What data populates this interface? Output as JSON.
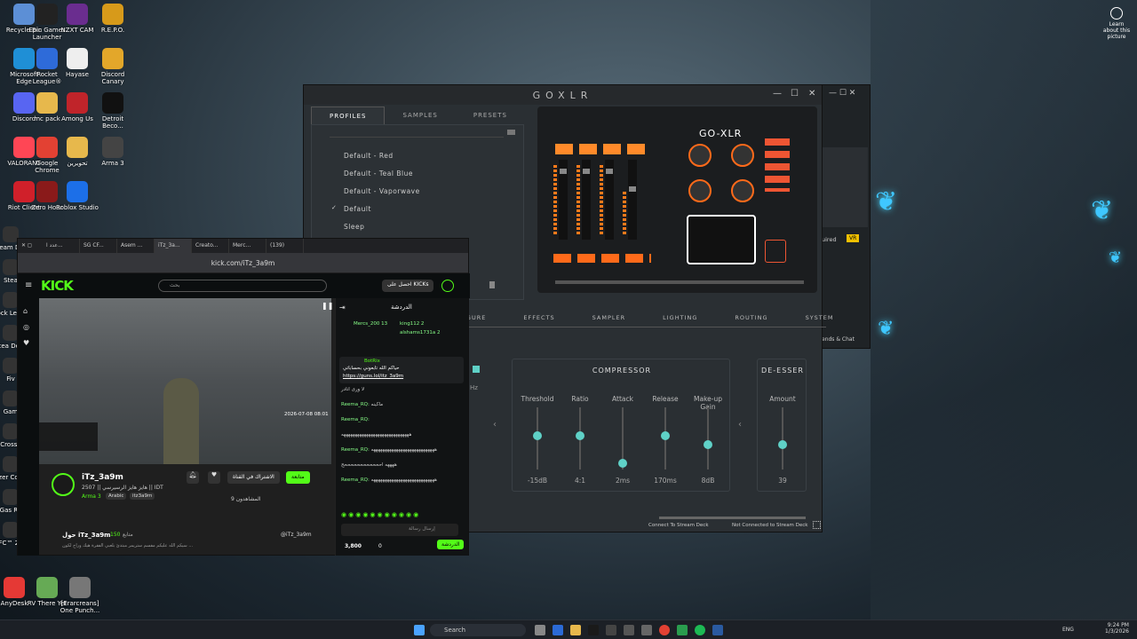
{
  "desktop": {
    "icons": [
      {
        "label": "Recycle Bin",
        "color": "#5c8fd6"
      },
      {
        "label": "Epic Games Launcher",
        "color": "#222",
        "glyph": "EPIC GAMES"
      },
      {
        "label": "NZXT CAM",
        "color": "#6a2d8f",
        "glyph": "NZXT"
      },
      {
        "label": "R.E.P.O.",
        "color": "#d79a1a"
      },
      {
        "label": "Microsoft Edge",
        "color": "#1f8fd6"
      },
      {
        "label": "Rocket League®",
        "color": "#2e6bd9"
      },
      {
        "label": "Hayase",
        "color": "#eee"
      },
      {
        "label": "Discord Canary",
        "color": "#e3a72a"
      },
      {
        "label": "Discord",
        "color": "#5865f2"
      },
      {
        "label": "mc pack",
        "color": "#e7b84c"
      },
      {
        "label": "Among Us",
        "color": "#c0242a"
      },
      {
        "label": "Detroit Beco...",
        "color": "#111"
      },
      {
        "label": "VALORANT",
        "color": "#ff4655"
      },
      {
        "label": "Google Chrome",
        "color": "#e34133"
      },
      {
        "label": "تحويرين",
        "color": "#e7b84c"
      },
      {
        "label": "Arma 3",
        "color": "#444"
      },
      {
        "label": "Riot Client",
        "color": "#d0202a"
      },
      {
        "label": "Zero Hour",
        "color": "#8a1a1a"
      },
      {
        "label": "Roblox Studio",
        "color": "#1c6fe8"
      }
    ],
    "left_edge_labels": [
      "Stream Deck",
      "Stea",
      "Rock Leagu",
      "Stea Deck",
      "Fiv",
      "Gam",
      "Crossh",
      "Razer Cortex",
      "Gas RP",
      "FC™ 26"
    ],
    "bottom_icons": [
      {
        "label": "AnyDesk",
        "color": "#e53935"
      },
      {
        "label": "RV There Yet",
        "color": "#6a5"
      },
      {
        "label": "[Erarcreans] One Punch...",
        "color": "#777"
      }
    ],
    "learn": "Learn about this picture"
  },
  "goxlr": {
    "title": "GOXLR",
    "tabs_top": [
      "PROFILES",
      "SAMPLES",
      "PRESETS"
    ],
    "profiles": [
      "Default - Red",
      "Default - Teal Blue",
      "Default - Vaporwave",
      "Default",
      "Sleep"
    ],
    "active_profile": "Default",
    "device_logo": "GO-XLR",
    "tabs_bottom": [
      "IGURE",
      "EFFECTS",
      "SAMPLER",
      "LIGHTING",
      "ROUTING",
      "SYSTEM"
    ],
    "compressor_title": "COMPRESSOR",
    "deesser_title": "DE-ESSER",
    "compressor": [
      {
        "label": "Threshold",
        "value": "-15dB",
        "level": 0.55
      },
      {
        "label": "Ratio",
        "value": "4:1",
        "level": 0.55
      },
      {
        "label": "Attack",
        "value": "2ms",
        "level": 0.1
      },
      {
        "label": "Release",
        "value": "170ms",
        "level": 0.55
      },
      {
        "label": "Make-up Gain",
        "value": "8dB",
        "level": 0.4
      }
    ],
    "deesser": {
      "label": "Amount",
      "value": "39",
      "level": 0.4
    },
    "hz": "Hz",
    "footer": [
      "Connect To Stream Deck",
      "Not Connected to Stream Deck"
    ]
  },
  "behind_window": {
    "tag": "uired",
    "badge": "VR",
    "footer": "ends & Chat"
  },
  "browser": {
    "tabs": [
      "عدد ا...",
      "SG CF...",
      "Asem ...",
      "iTz_3a...",
      "Creato...",
      "Merc...",
      "(139)"
    ],
    "url": "kick.com/iTz_3a9m",
    "logo": "KICK",
    "search_placeholder": "بحث",
    "kicks_button": "احصل على KICKs",
    "chat_title": "الدردشة",
    "channel": "iTz_3a9m",
    "stream_title": "هايز هايز الرسيرسي || 2507 || IDT",
    "game": "Arma 3",
    "tags": [
      "Arabic",
      "itz3a9m"
    ],
    "follow": "متابعة",
    "subscribe": "الاشتراك في القناة",
    "viewers_label": "المشاهدون",
    "viewers": "9",
    "about": "حول iTz_3a9m",
    "followers": "150",
    "followers_label": "متابع",
    "social": "@iTz_3a9m",
    "about_text": "سيكم الله عليكم مفسم ستريمر مبتدئ بلعبي الفقرة هيك وراح لكون ...",
    "video_timestamp": "2026-07-08 08:01",
    "top_gifters": [
      {
        "name": "Mercs_200",
        "val": "13"
      },
      {
        "name": "king112",
        "val": "2"
      },
      {
        "name": "alshams1731a",
        "val": "2"
      }
    ],
    "pinned": {
      "user": "BotRix",
      "text": "حياكم الله تابعوني بحساباتي",
      "link": "https://guns.lol/itz_3a9m"
    },
    "messages": [
      {
        "user": "",
        "text": "لا ورى انادر"
      },
      {
        "user": "Reema_RQ:",
        "text": "ماكينه"
      },
      {
        "user": "Reema_RQ:",
        "text": ""
      },
      {
        "user": "",
        "text": "ههههههههههههههههههههههههههههههه"
      },
      {
        "user": "Reema_RQ:",
        "text": "ههههههههههههههههههههههههههههه"
      },
      {
        "user": "",
        "text": "ههههه اححححححححححححح"
      },
      {
        "user": "Reema_RQ:",
        "text": "ههههههههههههههههههههههههههههه"
      }
    ],
    "chat_placeholder": "إرسال رسالة",
    "points": "3,800",
    "zero": "0",
    "chat_button": "الدردشة"
  },
  "taskbar": {
    "search": "Search",
    "lang": "ENG",
    "time": "9:24 PM",
    "date": "1/3/2026"
  }
}
